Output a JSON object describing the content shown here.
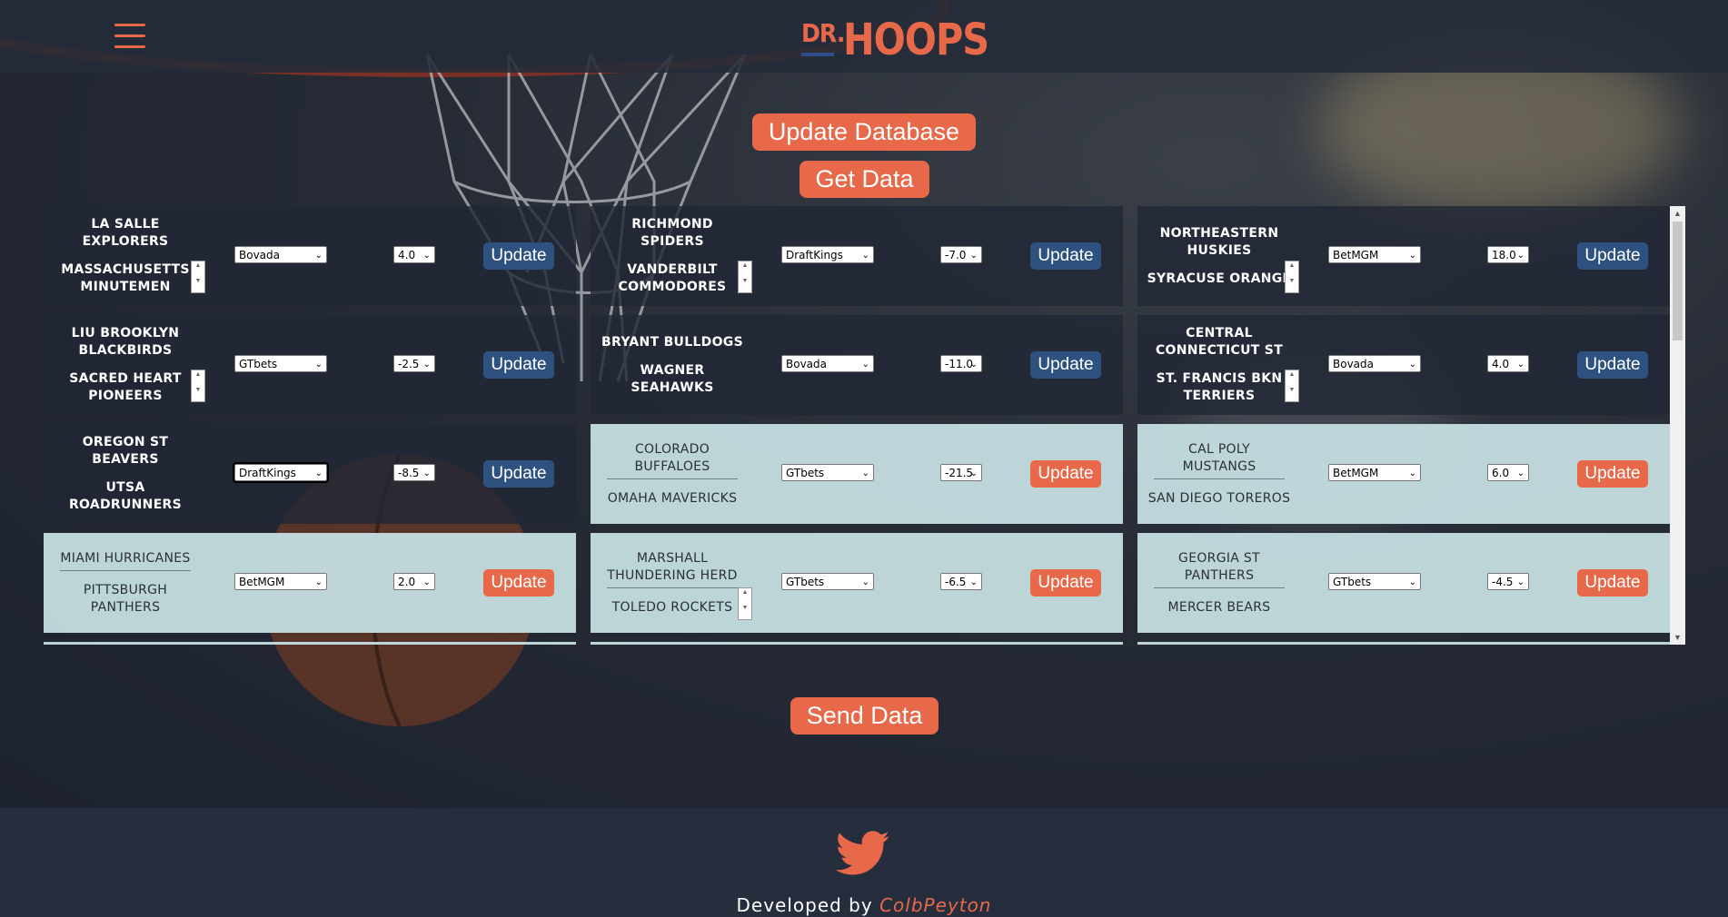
{
  "header": {
    "logo_dr": "DR.",
    "logo_hoops": "HOOPS",
    "menu_icon": "hamburger-menu-icon",
    "accent_color": "#e8684a"
  },
  "actions": {
    "update_database": "Update Database",
    "get_data": "Get Data",
    "send_data": "Send Data"
  },
  "games": [
    {
      "away": "LA SALLE EXPLORERS",
      "home": "MASSACHUSETTS MINUTEMEN",
      "book": "Bovada",
      "spread": "4.0",
      "button": "Update",
      "state": "pending"
    },
    {
      "away": "RICHMOND SPIDERS",
      "home": "VANDERBILT COMMODORES",
      "book": "DraftKings",
      "spread": "-7.0",
      "button": "Update",
      "state": "pending"
    },
    {
      "away": "NORTHEASTERN HUSKIES",
      "home": "SYRACUSE ORANGE",
      "book": "BetMGM",
      "spread": "18.0",
      "button": "Update",
      "state": "pending"
    },
    {
      "away": "LIU BROOKLYN BLACKBIRDS",
      "home": "SACRED HEART PIONEERS",
      "book": "GTbets",
      "spread": "-2.5",
      "button": "Update",
      "state": "pending"
    },
    {
      "away": "BRYANT BULLDOGS",
      "home": "WAGNER SEAHAWKS",
      "book": "Bovada",
      "spread": "-11.0",
      "button": "Update",
      "state": "pending"
    },
    {
      "away": "CENTRAL CONNECTICUT ST",
      "home": "ST. FRANCIS BKN TERRIERS",
      "book": "Bovada",
      "spread": "4.0",
      "button": "Update",
      "state": "pending"
    },
    {
      "away": "OREGON ST BEAVERS",
      "home": "UTSA ROADRUNNERS",
      "book": "DraftKings",
      "spread": "-8.5",
      "button": "Update",
      "state": "pending"
    },
    {
      "away": "COLORADO BUFFALOES",
      "home": "OMAHA MAVERICKS",
      "book": "GTbets",
      "spread": "-21.5",
      "button": "Update",
      "state": "updated"
    },
    {
      "away": "CAL POLY MUSTANGS",
      "home": "SAN DIEGO TOREROS",
      "book": "BetMGM",
      "spread": "6.0",
      "button": "Update",
      "state": "updated"
    },
    {
      "away": "MIAMI HURRICANES",
      "home": "PITTSBURGH PANTHERS",
      "book": "BetMGM",
      "spread": "2.0",
      "button": "Update",
      "state": "updated"
    },
    {
      "away": "MARSHALL THUNDERING HERD",
      "home": "TOLEDO ROCKETS",
      "book": "GTbets",
      "spread": "-6.5",
      "button": "Update",
      "state": "updated"
    },
    {
      "away": "GEORGIA ST PANTHERS",
      "home": "MERCER BEARS",
      "book": "GTbets",
      "spread": "-4.5",
      "button": "Update",
      "state": "updated"
    }
  ],
  "footer": {
    "icon": "twitter-bird-icon",
    "developed_by": "Developed by",
    "author": "ColbPeyton"
  }
}
